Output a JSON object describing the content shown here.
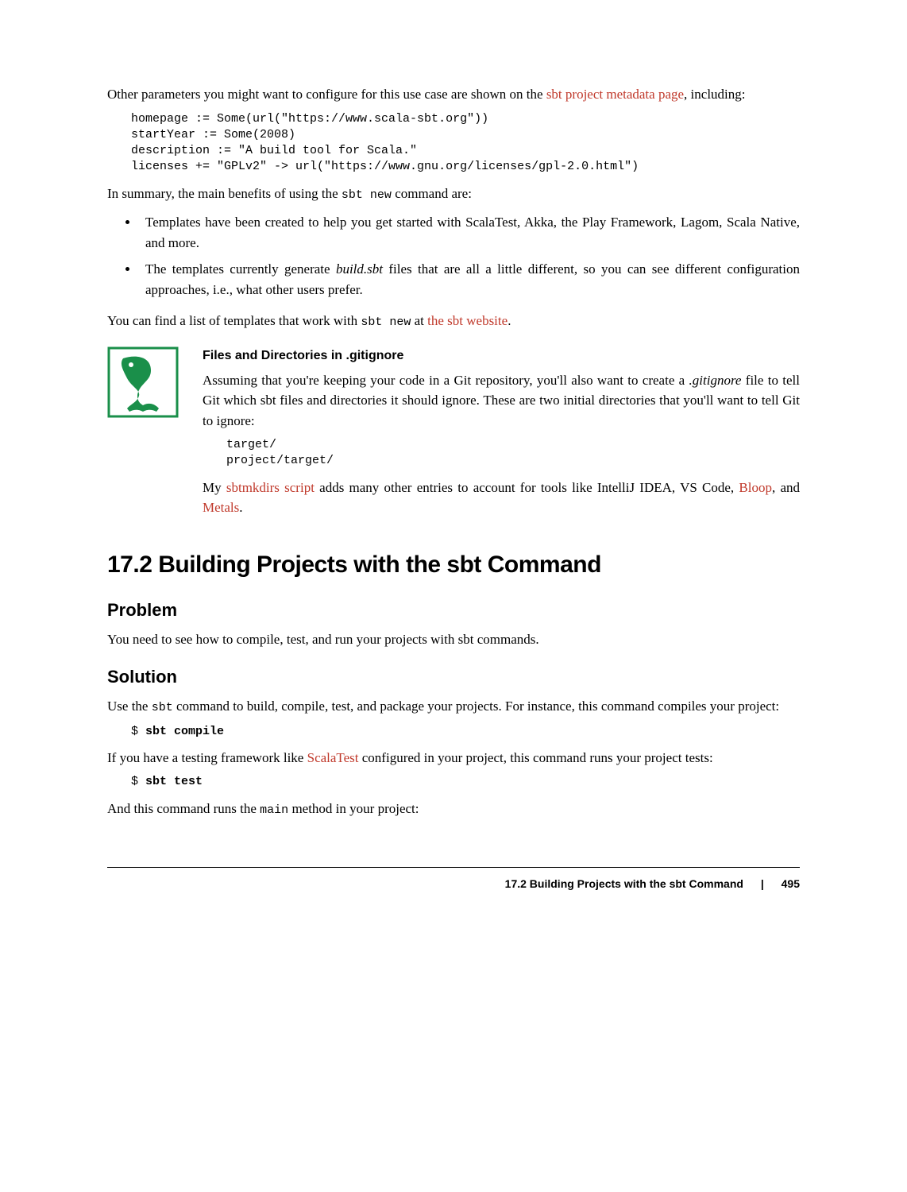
{
  "intro": {
    "para1_pre": "Other parameters you might want to configure for this use case are shown on the ",
    "link1": "sbt project metadata page",
    "para1_post": ", including:"
  },
  "code_block1": "homepage := Some(url(\"https://www.scala-sbt.org\"))\nstartYear := Some(2008)\ndescription := \"A build tool for Scala.\"\nlicenses += \"GPLv2\" -> url(\"https://www.gnu.org/licenses/gpl-2.0.html\")",
  "summary_pre": "In summary, the main benefits of using the ",
  "sbt_new": "sbt new",
  "summary_post": " command are:",
  "bullets": {
    "b1": "Templates have been created to help you get started with ScalaTest, Akka, the Play Framework, Lagom, Scala Native, and more.",
    "b2_pre": "The templates currently generate ",
    "b2_em": "build.sbt",
    "b2_post": " files that are all a little different, so you can see different configuration approaches, i.e., what other users prefer."
  },
  "templates_line": {
    "pre": "You can find a list of templates that work with ",
    "mid": " at ",
    "link": "the sbt website",
    "post": "."
  },
  "aside": {
    "title": "Files and Directories in .gitignore",
    "p1_pre": "Assuming that you're keeping your code in a Git repository, you'll also want to create a ",
    "p1_em": ".gitignore",
    "p1_post": " file to tell Git which sbt files and directories it should ignore. These are two initial directories that you'll want to tell Git to ignore:",
    "code": "target/\nproject/target/",
    "p2_pre": "My ",
    "p2_link1": "sbtmkdirs script",
    "p2_mid": " adds many other entries to account for tools like IntelliJ IDEA, VS Code, ",
    "p2_link2": "Bloop",
    "p2_sep": ", and ",
    "p2_link3": "Metals",
    "p2_post": "."
  },
  "section": {
    "title": "17.2 Building Projects with the sbt Command",
    "problem_h": "Problem",
    "problem_p": "You need to see how to compile, test, and run your projects with sbt commands.",
    "solution_h": "Solution",
    "sol_p1_pre": "Use the ",
    "sbt": "sbt",
    "sol_p1_post": " command to build, compile, test, and package your projects. For instance, this command compiles your project:",
    "cmd1_prompt": "$ ",
    "cmd1": "sbt compile",
    "sol_p2_pre": "If you have a testing framework like ",
    "scalatest_link": "ScalaTest",
    "sol_p2_post": " configured in your project, this command runs your project tests:",
    "cmd2_prompt": "$ ",
    "cmd2": "sbt test",
    "sol_p3_pre": "And this command runs the ",
    "main": "main",
    "sol_p3_post": " method in your project:"
  },
  "footer": {
    "title": "17.2 Building Projects with the sbt Command",
    "sep": "|",
    "page": "495"
  }
}
